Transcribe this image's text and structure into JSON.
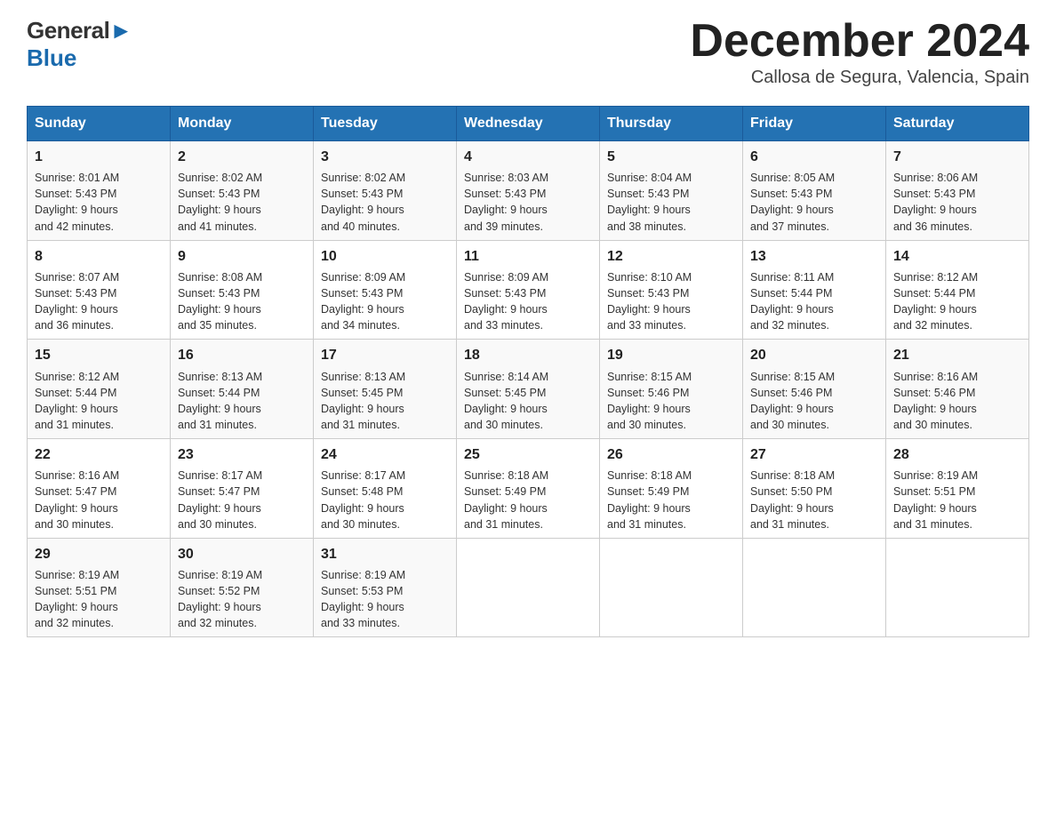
{
  "header": {
    "logo_general": "General",
    "logo_blue": "Blue",
    "month_title": "December 2024",
    "location": "Callosa de Segura, Valencia, Spain"
  },
  "days_of_week": [
    "Sunday",
    "Monday",
    "Tuesday",
    "Wednesday",
    "Thursday",
    "Friday",
    "Saturday"
  ],
  "weeks": [
    [
      {
        "day": "1",
        "sunrise": "8:01 AM",
        "sunset": "5:43 PM",
        "daylight": "9 hours and 42 minutes."
      },
      {
        "day": "2",
        "sunrise": "8:02 AM",
        "sunset": "5:43 PM",
        "daylight": "9 hours and 41 minutes."
      },
      {
        "day": "3",
        "sunrise": "8:02 AM",
        "sunset": "5:43 PM",
        "daylight": "9 hours and 40 minutes."
      },
      {
        "day": "4",
        "sunrise": "8:03 AM",
        "sunset": "5:43 PM",
        "daylight": "9 hours and 39 minutes."
      },
      {
        "day": "5",
        "sunrise": "8:04 AM",
        "sunset": "5:43 PM",
        "daylight": "9 hours and 38 minutes."
      },
      {
        "day": "6",
        "sunrise": "8:05 AM",
        "sunset": "5:43 PM",
        "daylight": "9 hours and 37 minutes."
      },
      {
        "day": "7",
        "sunrise": "8:06 AM",
        "sunset": "5:43 PM",
        "daylight": "9 hours and 36 minutes."
      }
    ],
    [
      {
        "day": "8",
        "sunrise": "8:07 AM",
        "sunset": "5:43 PM",
        "daylight": "9 hours and 36 minutes."
      },
      {
        "day": "9",
        "sunrise": "8:08 AM",
        "sunset": "5:43 PM",
        "daylight": "9 hours and 35 minutes."
      },
      {
        "day": "10",
        "sunrise": "8:09 AM",
        "sunset": "5:43 PM",
        "daylight": "9 hours and 34 minutes."
      },
      {
        "day": "11",
        "sunrise": "8:09 AM",
        "sunset": "5:43 PM",
        "daylight": "9 hours and 33 minutes."
      },
      {
        "day": "12",
        "sunrise": "8:10 AM",
        "sunset": "5:43 PM",
        "daylight": "9 hours and 33 minutes."
      },
      {
        "day": "13",
        "sunrise": "8:11 AM",
        "sunset": "5:44 PM",
        "daylight": "9 hours and 32 minutes."
      },
      {
        "day": "14",
        "sunrise": "8:12 AM",
        "sunset": "5:44 PM",
        "daylight": "9 hours and 32 minutes."
      }
    ],
    [
      {
        "day": "15",
        "sunrise": "8:12 AM",
        "sunset": "5:44 PM",
        "daylight": "9 hours and 31 minutes."
      },
      {
        "day": "16",
        "sunrise": "8:13 AM",
        "sunset": "5:44 PM",
        "daylight": "9 hours and 31 minutes."
      },
      {
        "day": "17",
        "sunrise": "8:13 AM",
        "sunset": "5:45 PM",
        "daylight": "9 hours and 31 minutes."
      },
      {
        "day": "18",
        "sunrise": "8:14 AM",
        "sunset": "5:45 PM",
        "daylight": "9 hours and 30 minutes."
      },
      {
        "day": "19",
        "sunrise": "8:15 AM",
        "sunset": "5:46 PM",
        "daylight": "9 hours and 30 minutes."
      },
      {
        "day": "20",
        "sunrise": "8:15 AM",
        "sunset": "5:46 PM",
        "daylight": "9 hours and 30 minutes."
      },
      {
        "day": "21",
        "sunrise": "8:16 AM",
        "sunset": "5:46 PM",
        "daylight": "9 hours and 30 minutes."
      }
    ],
    [
      {
        "day": "22",
        "sunrise": "8:16 AM",
        "sunset": "5:47 PM",
        "daylight": "9 hours and 30 minutes."
      },
      {
        "day": "23",
        "sunrise": "8:17 AM",
        "sunset": "5:47 PM",
        "daylight": "9 hours and 30 minutes."
      },
      {
        "day": "24",
        "sunrise": "8:17 AM",
        "sunset": "5:48 PM",
        "daylight": "9 hours and 30 minutes."
      },
      {
        "day": "25",
        "sunrise": "8:18 AM",
        "sunset": "5:49 PM",
        "daylight": "9 hours and 31 minutes."
      },
      {
        "day": "26",
        "sunrise": "8:18 AM",
        "sunset": "5:49 PM",
        "daylight": "9 hours and 31 minutes."
      },
      {
        "day": "27",
        "sunrise": "8:18 AM",
        "sunset": "5:50 PM",
        "daylight": "9 hours and 31 minutes."
      },
      {
        "day": "28",
        "sunrise": "8:19 AM",
        "sunset": "5:51 PM",
        "daylight": "9 hours and 31 minutes."
      }
    ],
    [
      {
        "day": "29",
        "sunrise": "8:19 AM",
        "sunset": "5:51 PM",
        "daylight": "9 hours and 32 minutes."
      },
      {
        "day": "30",
        "sunrise": "8:19 AM",
        "sunset": "5:52 PM",
        "daylight": "9 hours and 32 minutes."
      },
      {
        "day": "31",
        "sunrise": "8:19 AM",
        "sunset": "5:53 PM",
        "daylight": "9 hours and 33 minutes."
      },
      null,
      null,
      null,
      null
    ]
  ],
  "labels": {
    "sunrise": "Sunrise:",
    "sunset": "Sunset:",
    "daylight": "Daylight:"
  }
}
